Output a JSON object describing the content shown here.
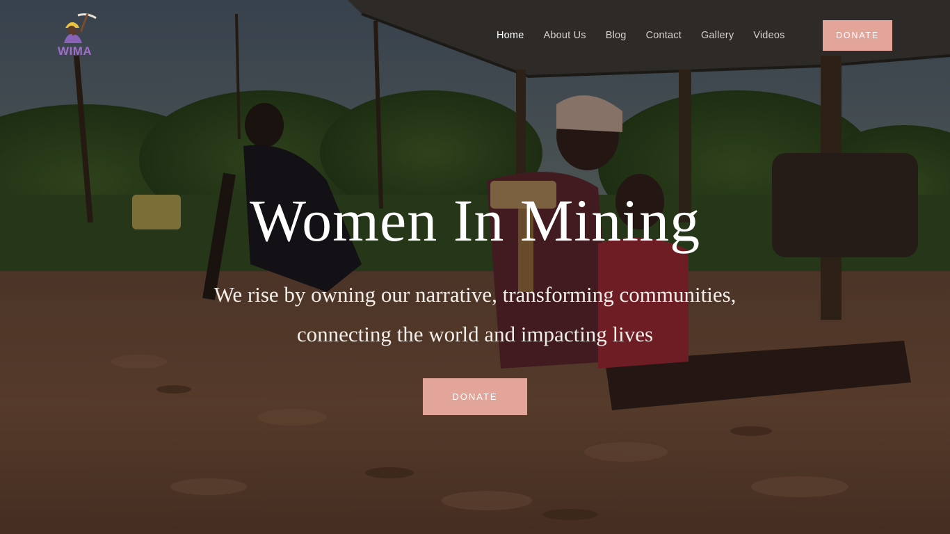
{
  "brand": {
    "logo_text": "WIMA",
    "logo_icon": "miner-with-pickaxe-icon"
  },
  "nav": {
    "items": [
      {
        "label": "Home",
        "active": true
      },
      {
        "label": "About Us",
        "active": false
      },
      {
        "label": "Blog",
        "active": false
      },
      {
        "label": "Contact",
        "active": false
      },
      {
        "label": "Gallery",
        "active": false
      },
      {
        "label": "Videos",
        "active": false
      }
    ],
    "donate_label": "DONATE"
  },
  "hero": {
    "title": "Women In Mining",
    "subtitle": "We rise by owning our narrative, transforming communities, connecting the world and impacting lives",
    "donate_label": "DONATE"
  },
  "colors": {
    "accent": "#e3a49a",
    "logo": "#a06ec8",
    "text": "#ffffff"
  }
}
